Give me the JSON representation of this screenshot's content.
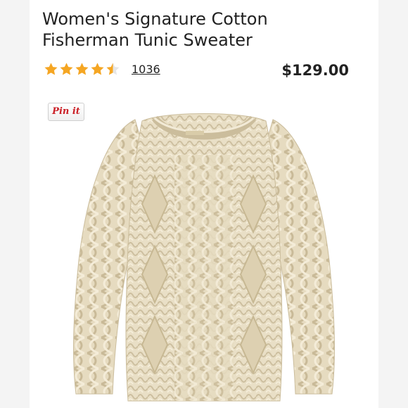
{
  "product": {
    "title_line1": "Women's Signature Cotton",
    "title_line2": "Fisherman Tunic Sweater",
    "rating": 4.5,
    "rating_max": 5,
    "review_count": "1036",
    "price": "$129.00"
  },
  "pinit_label": "Pin it",
  "colors": {
    "star": "#f5a623",
    "star_empty": "#cccccc",
    "sweater": "#e9dfc6",
    "pinit_red": "#cb2027"
  }
}
